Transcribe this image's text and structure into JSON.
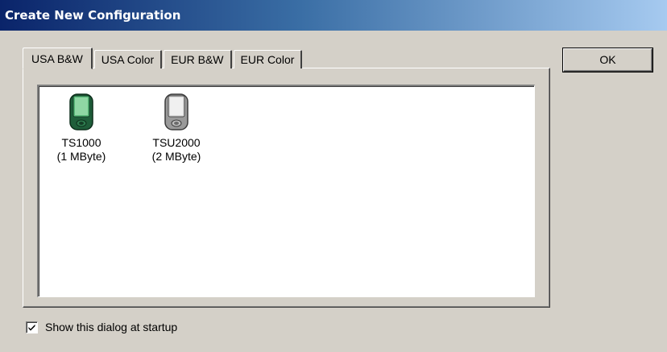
{
  "window": {
    "title": "Create New Configuration",
    "title_colors": {
      "start": "#0a246a",
      "end": "#a6caf0"
    }
  },
  "tabs": [
    {
      "label": "USA B&W",
      "active": true
    },
    {
      "label": "USA Color",
      "active": false
    },
    {
      "label": "EUR B&W",
      "active": false
    },
    {
      "label": "EUR Color",
      "active": false
    }
  ],
  "devices": [
    {
      "name": "TS1000",
      "memory": "(1 MByte)",
      "icon": "handheld-device-green-icon",
      "color": "#2e7d4f"
    },
    {
      "name": "TSU2000",
      "memory": "(2 MByte)",
      "icon": "handheld-device-gray-icon",
      "color": "#b0b0b0"
    }
  ],
  "buttons": {
    "ok_label": "OK"
  },
  "startup_checkbox": {
    "label": "Show this dialog at startup",
    "checked": true
  }
}
